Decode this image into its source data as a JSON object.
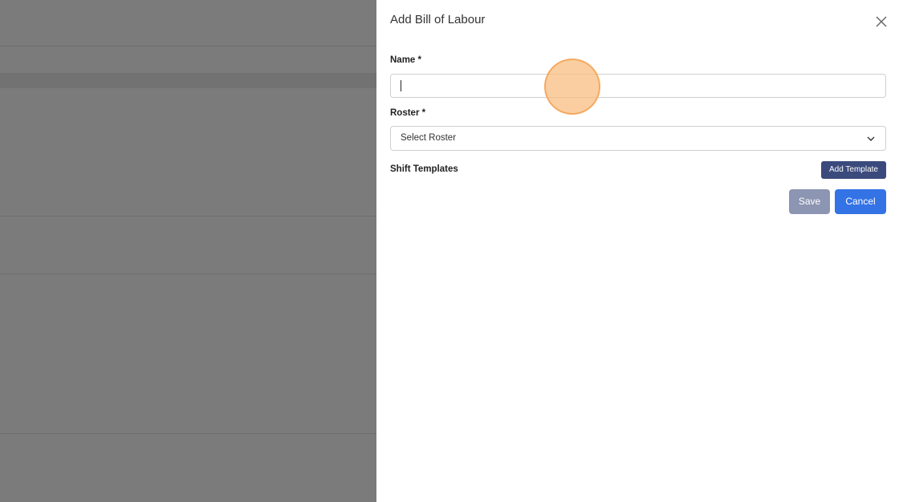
{
  "drawer": {
    "title": "Add Bill of Labour",
    "close_icon": "close-icon"
  },
  "form": {
    "name_label": "Name *",
    "name_value": "",
    "roster_label": "Roster *",
    "roster_selected": "Select Roster",
    "roster_icon": "chevron-down-icon",
    "shift_templates_label": "Shift Templates",
    "add_template_label": "Add Template"
  },
  "actions": {
    "save_label": "Save",
    "cancel_label": "Cancel"
  },
  "colors": {
    "overlay": "#7b7b7c",
    "primary": "#3373e6",
    "secondary_dark": "#3b4a7c",
    "disabled": "#8c95b2"
  }
}
